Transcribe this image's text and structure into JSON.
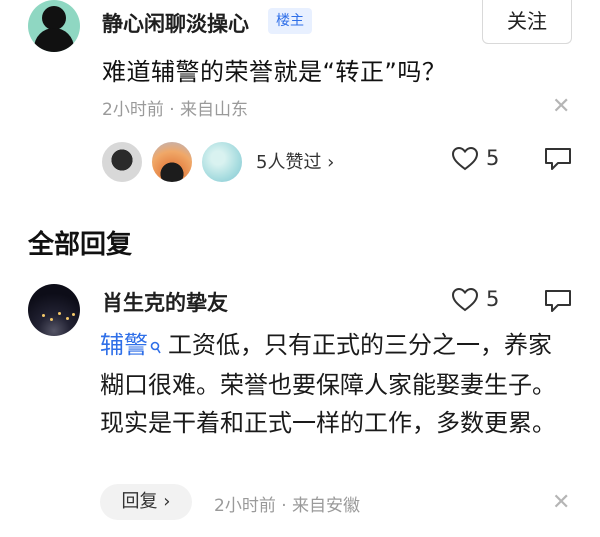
{
  "post": {
    "username": "静心闲聊淡操心",
    "badge": "楼主",
    "follow_label": "关注",
    "text": "难道辅警的荣誉就是“转正”吗？",
    "time_source": "2小时前 · 来自山东",
    "likes_summary": "5人赞过 ›",
    "like_count": "5"
  },
  "section_title": "全部回复",
  "reply": {
    "username": "肖生克的挚友",
    "like_count": "5",
    "keyword": "辅警",
    "text": "工资低，只有正式的三分之一，养家糊口很难。荣誉也要保障人家能娶妻生子。现实是干着和正式一样的工作，多数更累。",
    "reply_label": "回复 ›",
    "time_source": "2小时前 · 来自安徽"
  },
  "icons": {
    "close": "close-icon",
    "heart": "heart-icon",
    "reply": "reply-icon",
    "search": "search-icon"
  },
  "colors": {
    "accent_blue": "#2f6fe8",
    "badge_bg": "#e8f0ff",
    "meta_gray": "#9a9a9a"
  }
}
